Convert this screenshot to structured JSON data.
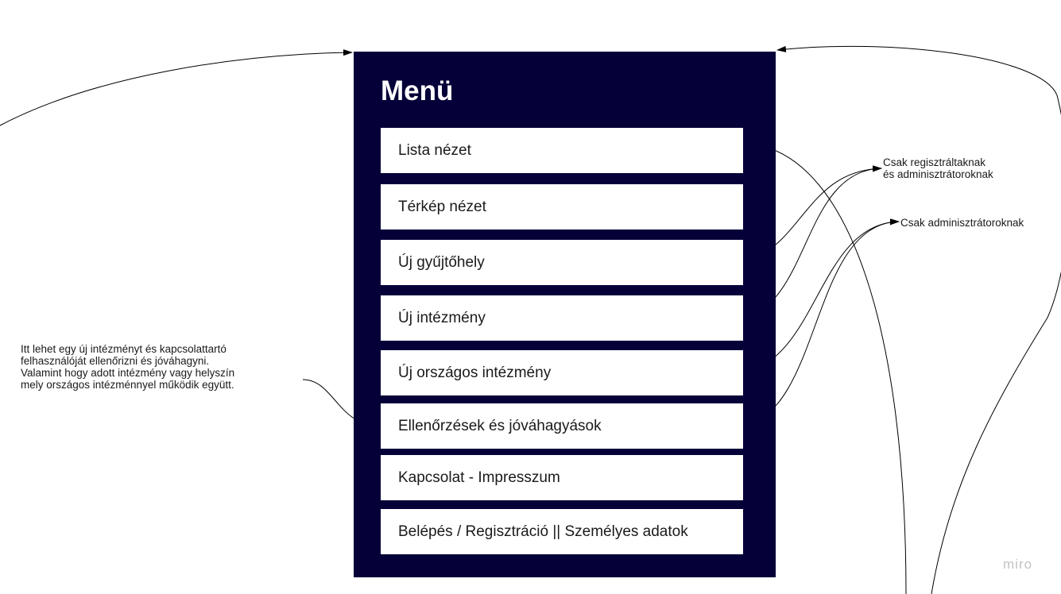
{
  "menu": {
    "title": "Menü",
    "items": [
      {
        "label": "Lista nézet"
      },
      {
        "label": "Térkép nézet"
      },
      {
        "label": "Új gyűjtőhely"
      },
      {
        "label": "Új intézmény"
      },
      {
        "label": "Új országos intézmény"
      },
      {
        "label": "Ellenőrzések és jóváhagyások"
      },
      {
        "label": "Kapcsolat - Impresszum"
      },
      {
        "label": "Belépés / Regisztráció || Személyes adatok"
      }
    ]
  },
  "annotations": {
    "left_note": "Itt lehet egy új intézményt és kapcsolattartó\nfelhasználóját ellenőrizni és jóváhagyni.\nValamint hogy adott intézmény vagy helyszín\nmely országos intézménnyel működik együtt.",
    "registered_note": "Csak regisztráltaknak\nés adminisztrátoroknak",
    "admin_note": "Csak adminisztrátoroknak"
  },
  "watermark": "miro",
  "colors": {
    "panel": "#050038",
    "item_background": "#ffffff",
    "connector": "#000000",
    "watermark": "#c2c2c2"
  }
}
